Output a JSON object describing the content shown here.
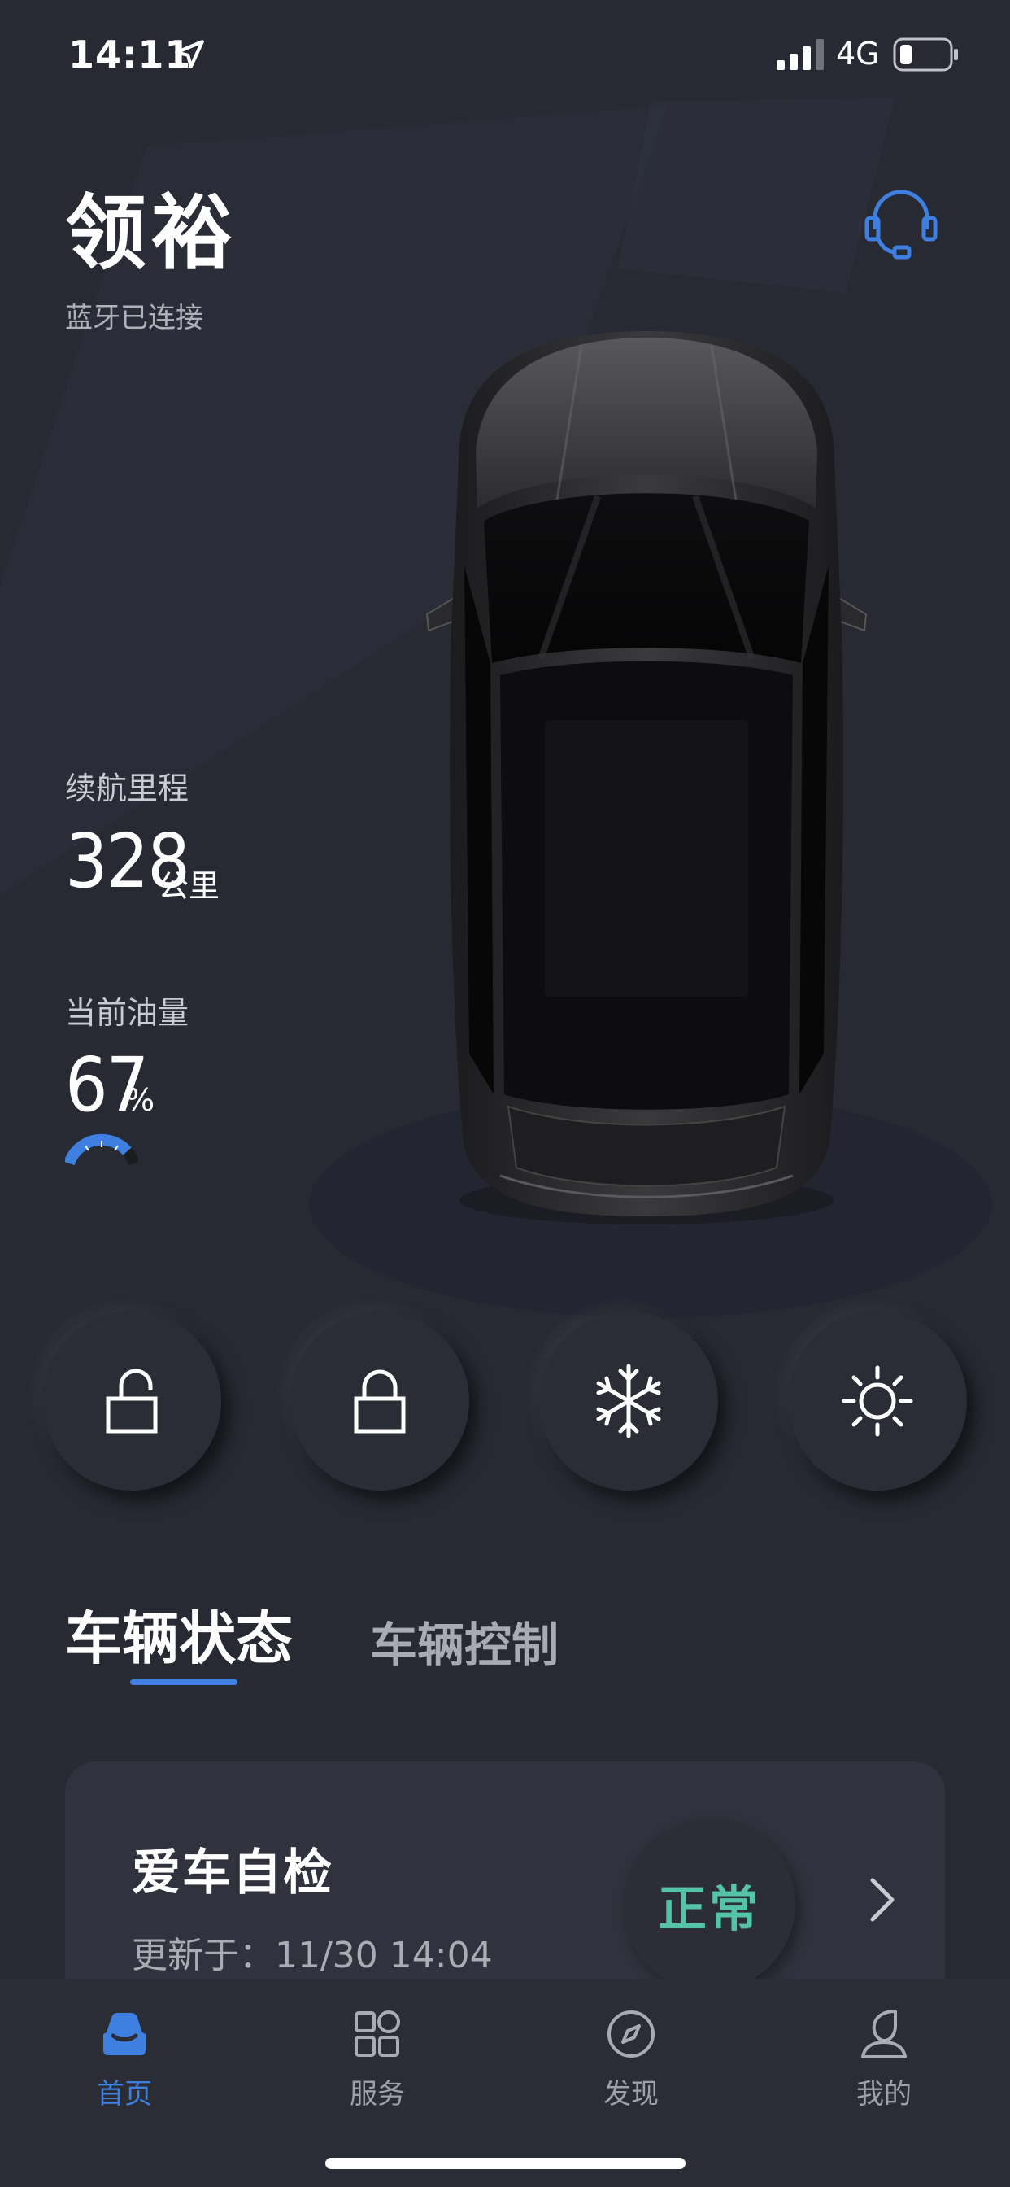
{
  "status_bar": {
    "time": "14:11",
    "network": "4G"
  },
  "header": {
    "car_name": "领裕",
    "bluetooth_status": "蓝牙已连接"
  },
  "stats": {
    "range_label": "续航里程",
    "range_value": "328",
    "range_unit": "公里",
    "fuel_label": "当前油量",
    "fuel_value": "67",
    "fuel_unit": "%",
    "fuel_level": 0.67
  },
  "quick_actions": [
    "unlock-icon",
    "lock-icon",
    "snowflake-icon",
    "sun-icon"
  ],
  "tabs": {
    "active": "车辆状态",
    "inactive": "车辆控制"
  },
  "check_card": {
    "title": "爱车自检",
    "updated": "更新于：11/30 14:04",
    "status": "正常"
  },
  "nav": [
    {
      "label": "首页",
      "icon": "car-home-icon",
      "active": true
    },
    {
      "label": "服务",
      "icon": "grid-icon"
    },
    {
      "label": "发现",
      "icon": "compass-icon"
    },
    {
      "label": "我的",
      "icon": "profile-icon"
    }
  ],
  "colors": {
    "accent": "#3e7fe0",
    "background": "#272a33",
    "status_ok": "#55c4a6"
  }
}
